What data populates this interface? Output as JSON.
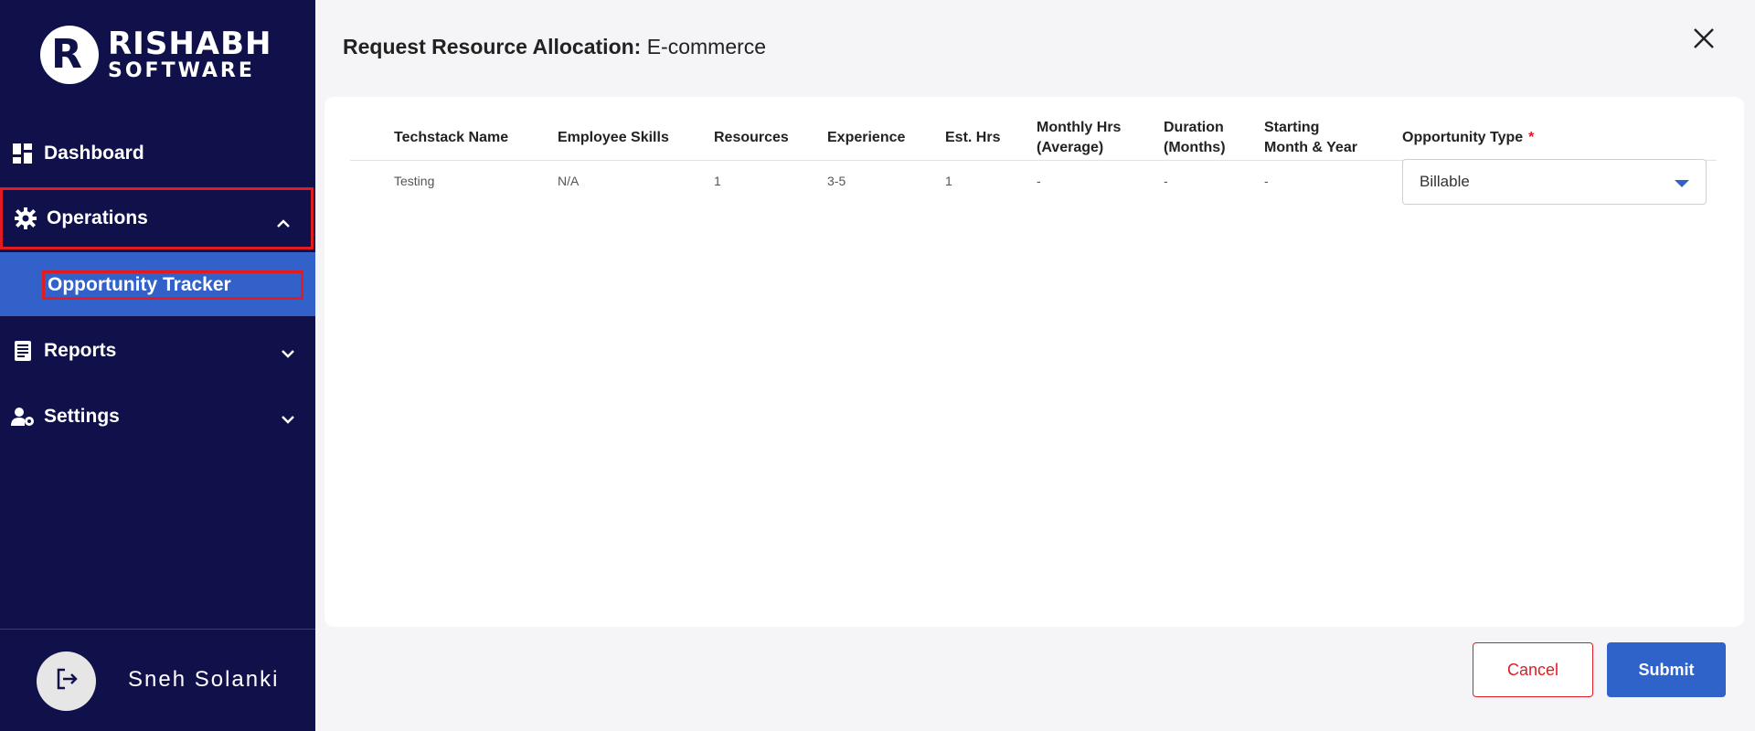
{
  "brand": {
    "line1": "RISHABH",
    "line2": "SOFTWARE",
    "mark": "R"
  },
  "nav": {
    "dashboard": {
      "label": "Dashboard",
      "icon": "dashboard-grid-icon"
    },
    "operations": {
      "label": "Operations",
      "icon": "gear-icon",
      "expanded": true
    },
    "operations_sub": [
      {
        "label": "Opportunity Tracker",
        "active": true
      }
    ],
    "reports": {
      "label": "Reports",
      "icon": "report-icon"
    },
    "settings": {
      "label": "Settings",
      "icon": "user-settings-icon"
    }
  },
  "user": {
    "name": "Sneh Solanki",
    "logout_icon": "logout-icon"
  },
  "dialog": {
    "title_prefix": "Request Resource Allocation:",
    "title_value": " E-commerce",
    "close_icon": "close-icon"
  },
  "table": {
    "headers": {
      "techstack": "Techstack Name",
      "skills": "Employee Skills",
      "resources": "Resources",
      "experience": "Experience",
      "est_hrs": "Est. Hrs",
      "monthly_l1": "Monthly Hrs",
      "monthly_l2": "(Average)",
      "duration_l1": "Duration",
      "duration_l2": "(Months)",
      "starting_l1": "Starting",
      "starting_l2": "Month & Year",
      "opp_type": "Opportunity Type",
      "required_mark": "*"
    },
    "rows": [
      {
        "techstack": "Testing",
        "skills": "N/A",
        "resources": "1",
        "experience": "3-5",
        "est_hrs": "1",
        "monthly": "-",
        "duration": "-",
        "starting": "-",
        "opp_type": "Billable"
      }
    ]
  },
  "actions": {
    "cancel": "Cancel",
    "submit": "Submit"
  },
  "colors": {
    "sidebar": "#10114b",
    "accent": "#3161c9",
    "danger": "#e21b23"
  }
}
